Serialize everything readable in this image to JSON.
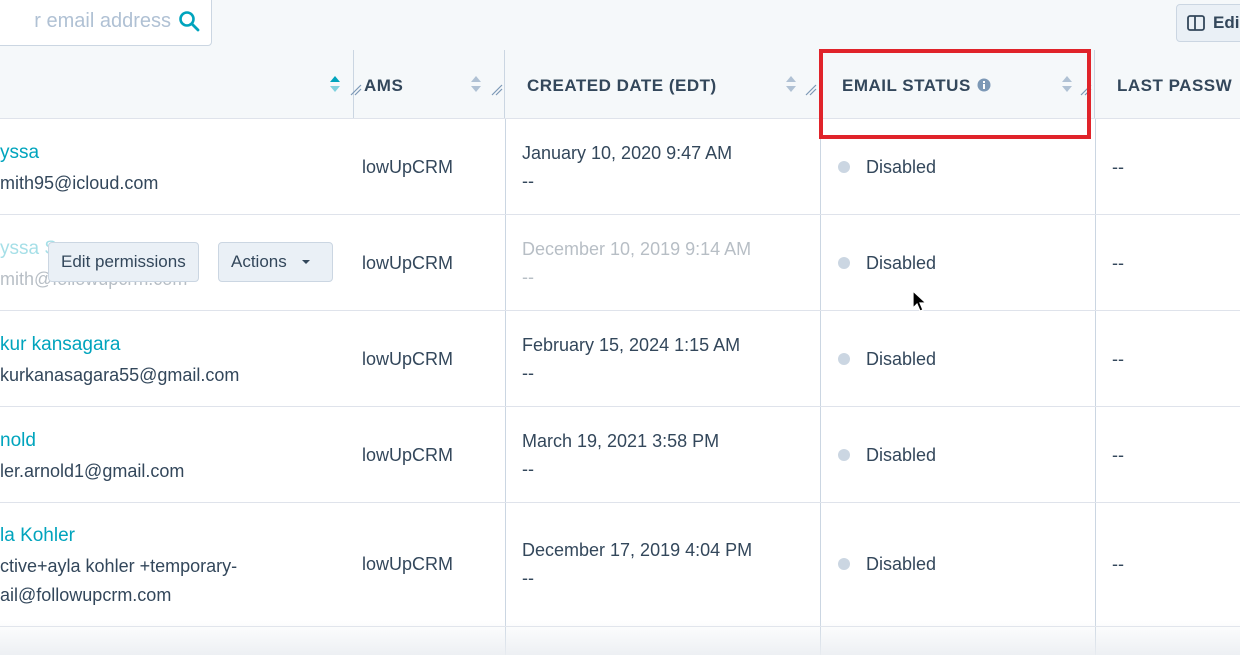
{
  "search": {
    "placeholder": "r email address"
  },
  "toolbar": {
    "edit_columns_label": "Edi"
  },
  "table": {
    "columns": [
      {
        "key": "name",
        "label": ""
      },
      {
        "key": "teams",
        "label": "AMS"
      },
      {
        "key": "created",
        "label": "CREATED DATE (EDT)"
      },
      {
        "key": "email_status",
        "label": "EMAIL STATUS"
      },
      {
        "key": "last_password",
        "label": "LAST PASSW"
      }
    ],
    "rows": [
      {
        "name": "yssa",
        "email": "mith95@icloud.com",
        "team": "lowUpCRM",
        "created": "January 10, 2020 9:47 AM",
        "created_sub": "--",
        "status": "Disabled",
        "last_password": "--"
      },
      {
        "name": "yssa S",
        "email": "mith@followupcrm.com",
        "team": "lowUpCRM",
        "created": "December 10, 2019 9:14 AM",
        "created_sub": "--",
        "status": "Disabled",
        "last_password": "--"
      },
      {
        "name": "kur kansagara",
        "email": "kurkanasagara55@gmail.com",
        "team": "lowUpCRM",
        "created": "February 15, 2024 1:15 AM",
        "created_sub": "--",
        "status": "Disabled",
        "last_password": "--"
      },
      {
        "name": "nold",
        "email": "ler.arnold1@gmail.com",
        "team": "lowUpCRM",
        "created": "March 19, 2021 3:58 PM",
        "created_sub": "--",
        "status": "Disabled",
        "last_password": "--"
      },
      {
        "name": "la Kohler",
        "email": "ctive+ayla kohler +temporary-",
        "email2": "ail@followupcrm.com",
        "team": "lowUpCRM",
        "created": "December 17, 2019 4:04 PM",
        "created_sub": "--",
        "status": "Disabled",
        "last_password": "--"
      },
      {
        "name": "",
        "email": "",
        "team": "",
        "created": "",
        "created_sub": "",
        "status": "",
        "last_password": ""
      }
    ]
  },
  "row_actions": {
    "edit_permissions_label": "Edit permissions",
    "actions_label": "Actions"
  },
  "colors": {
    "accent": "#00a4bd",
    "highlight": "#e0232a",
    "status_dot": "#cbd6e2"
  }
}
